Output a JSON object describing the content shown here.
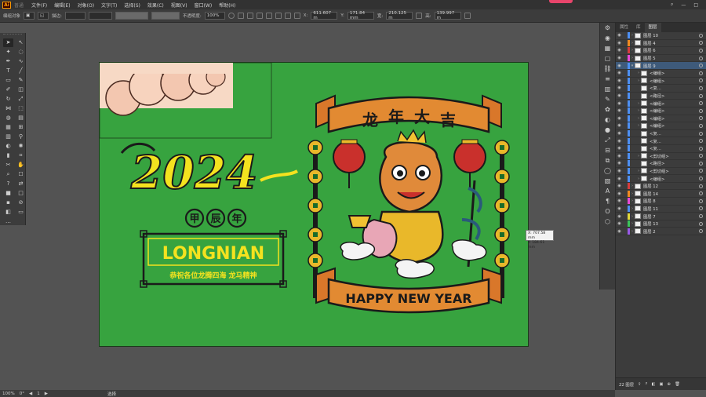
{
  "app": {
    "logo": "Ai",
    "mode": "普通"
  },
  "menu": [
    "文件(F)",
    "编辑(E)",
    "对象(O)",
    "文字(T)",
    "选择(S)",
    "效果(C)",
    "视图(V)",
    "窗口(W)",
    "帮助(H)"
  ],
  "control_bar": {
    "selection": "编组对象",
    "stroke_label": "描边:",
    "opacity_label": "不透明度:",
    "opacity_value": "100%",
    "x_label": "X:",
    "x_value": "611.607 m",
    "y_label": "Y:",
    "y_value": "171.84 mm",
    "w_label": "宽:",
    "w_value": "210.125 m",
    "h_label": "高:",
    "h_value": "139.997 m"
  },
  "artwork": {
    "year_text": "2024",
    "jiachen": [
      "甲",
      "辰",
      "年"
    ],
    "pinyin": "LONGNIAN",
    "slogan": "恭祝各位龙腾四海 龙马精神",
    "banner_top": [
      "龙",
      "年",
      "大",
      "吉"
    ],
    "banner_bottom": "HAPPY NEW YEAR"
  },
  "tooltip": {
    "x": "X: 707.58 mm",
    "y": "Y: 184.61 mm"
  },
  "layers_panel": {
    "tabs": [
      "属性",
      "库",
      "图层"
    ],
    "active_tab": "图层",
    "rows": [
      {
        "name": "图层 10",
        "color": "#4d8ff2",
        "indent": 0,
        "expand": ">"
      },
      {
        "name": "图层 4",
        "color": "#f08a20",
        "indent": 0,
        "expand": ">"
      },
      {
        "name": "图层 6",
        "color": "#d63c3c",
        "indent": 0,
        "expand": ">"
      },
      {
        "name": "图层 5",
        "color": "#e84ad6",
        "indent": 0,
        "expand": ">"
      },
      {
        "name": "图层 9",
        "color": "#4d8ff2",
        "indent": 0,
        "expand": "v",
        "highlight": true
      },
      {
        "name": "<编组>",
        "color": "#4d8ff2",
        "indent": 1,
        "expand": ">"
      },
      {
        "name": "<编组>",
        "color": "#4d8ff2",
        "indent": 1,
        "expand": ">"
      },
      {
        "name": "<复...",
        "color": "#4d8ff2",
        "indent": 1,
        "expand": ""
      },
      {
        "name": "<路径>",
        "color": "#4d8ff2",
        "indent": 1,
        "expand": ""
      },
      {
        "name": "<编组>",
        "color": "#4d8ff2",
        "indent": 1,
        "expand": ">"
      },
      {
        "name": "<编组>",
        "color": "#4d8ff2",
        "indent": 1,
        "expand": ">"
      },
      {
        "name": "<编组>",
        "color": "#4d8ff2",
        "indent": 1,
        "expand": ">"
      },
      {
        "name": "<编组>",
        "color": "#4d8ff2",
        "indent": 1,
        "expand": ">"
      },
      {
        "name": "<复...",
        "color": "#4d8ff2",
        "indent": 1,
        "expand": ""
      },
      {
        "name": "<复...",
        "color": "#4d8ff2",
        "indent": 1,
        "expand": ""
      },
      {
        "name": "<复...",
        "color": "#4d8ff2",
        "indent": 1,
        "expand": ""
      },
      {
        "name": "<剪切组>",
        "color": "#4d8ff2",
        "indent": 1,
        "expand": ">"
      },
      {
        "name": "<路径>",
        "color": "#4d8ff2",
        "indent": 1,
        "expand": ""
      },
      {
        "name": "<剪切组>",
        "color": "#4d8ff2",
        "indent": 1,
        "expand": ">"
      },
      {
        "name": "<编组>",
        "color": "#4d8ff2",
        "indent": 1,
        "expand": ">"
      },
      {
        "name": "图层 12",
        "color": "#d63c3c",
        "indent": 0,
        "expand": ">"
      },
      {
        "name": "图层 14",
        "color": "#f08a20",
        "indent": 0,
        "expand": ">"
      },
      {
        "name": "图层 8",
        "color": "#e84ad6",
        "indent": 0,
        "expand": ">"
      },
      {
        "name": "图层 11",
        "color": "#4d8ff2",
        "indent": 0,
        "expand": ">"
      },
      {
        "name": "图层 7",
        "color": "#e0d83a",
        "indent": 0,
        "expand": ">"
      },
      {
        "name": "图层 13",
        "color": "#3cc35a",
        "indent": 0,
        "expand": ">"
      },
      {
        "name": "图层 2",
        "color": "#9a5ae8",
        "indent": 0,
        "expand": ">"
      }
    ],
    "footer": "22 图层"
  },
  "status": {
    "zoom": "100%",
    "rotation": "0°",
    "artboard": "1",
    "tool": "选择"
  }
}
